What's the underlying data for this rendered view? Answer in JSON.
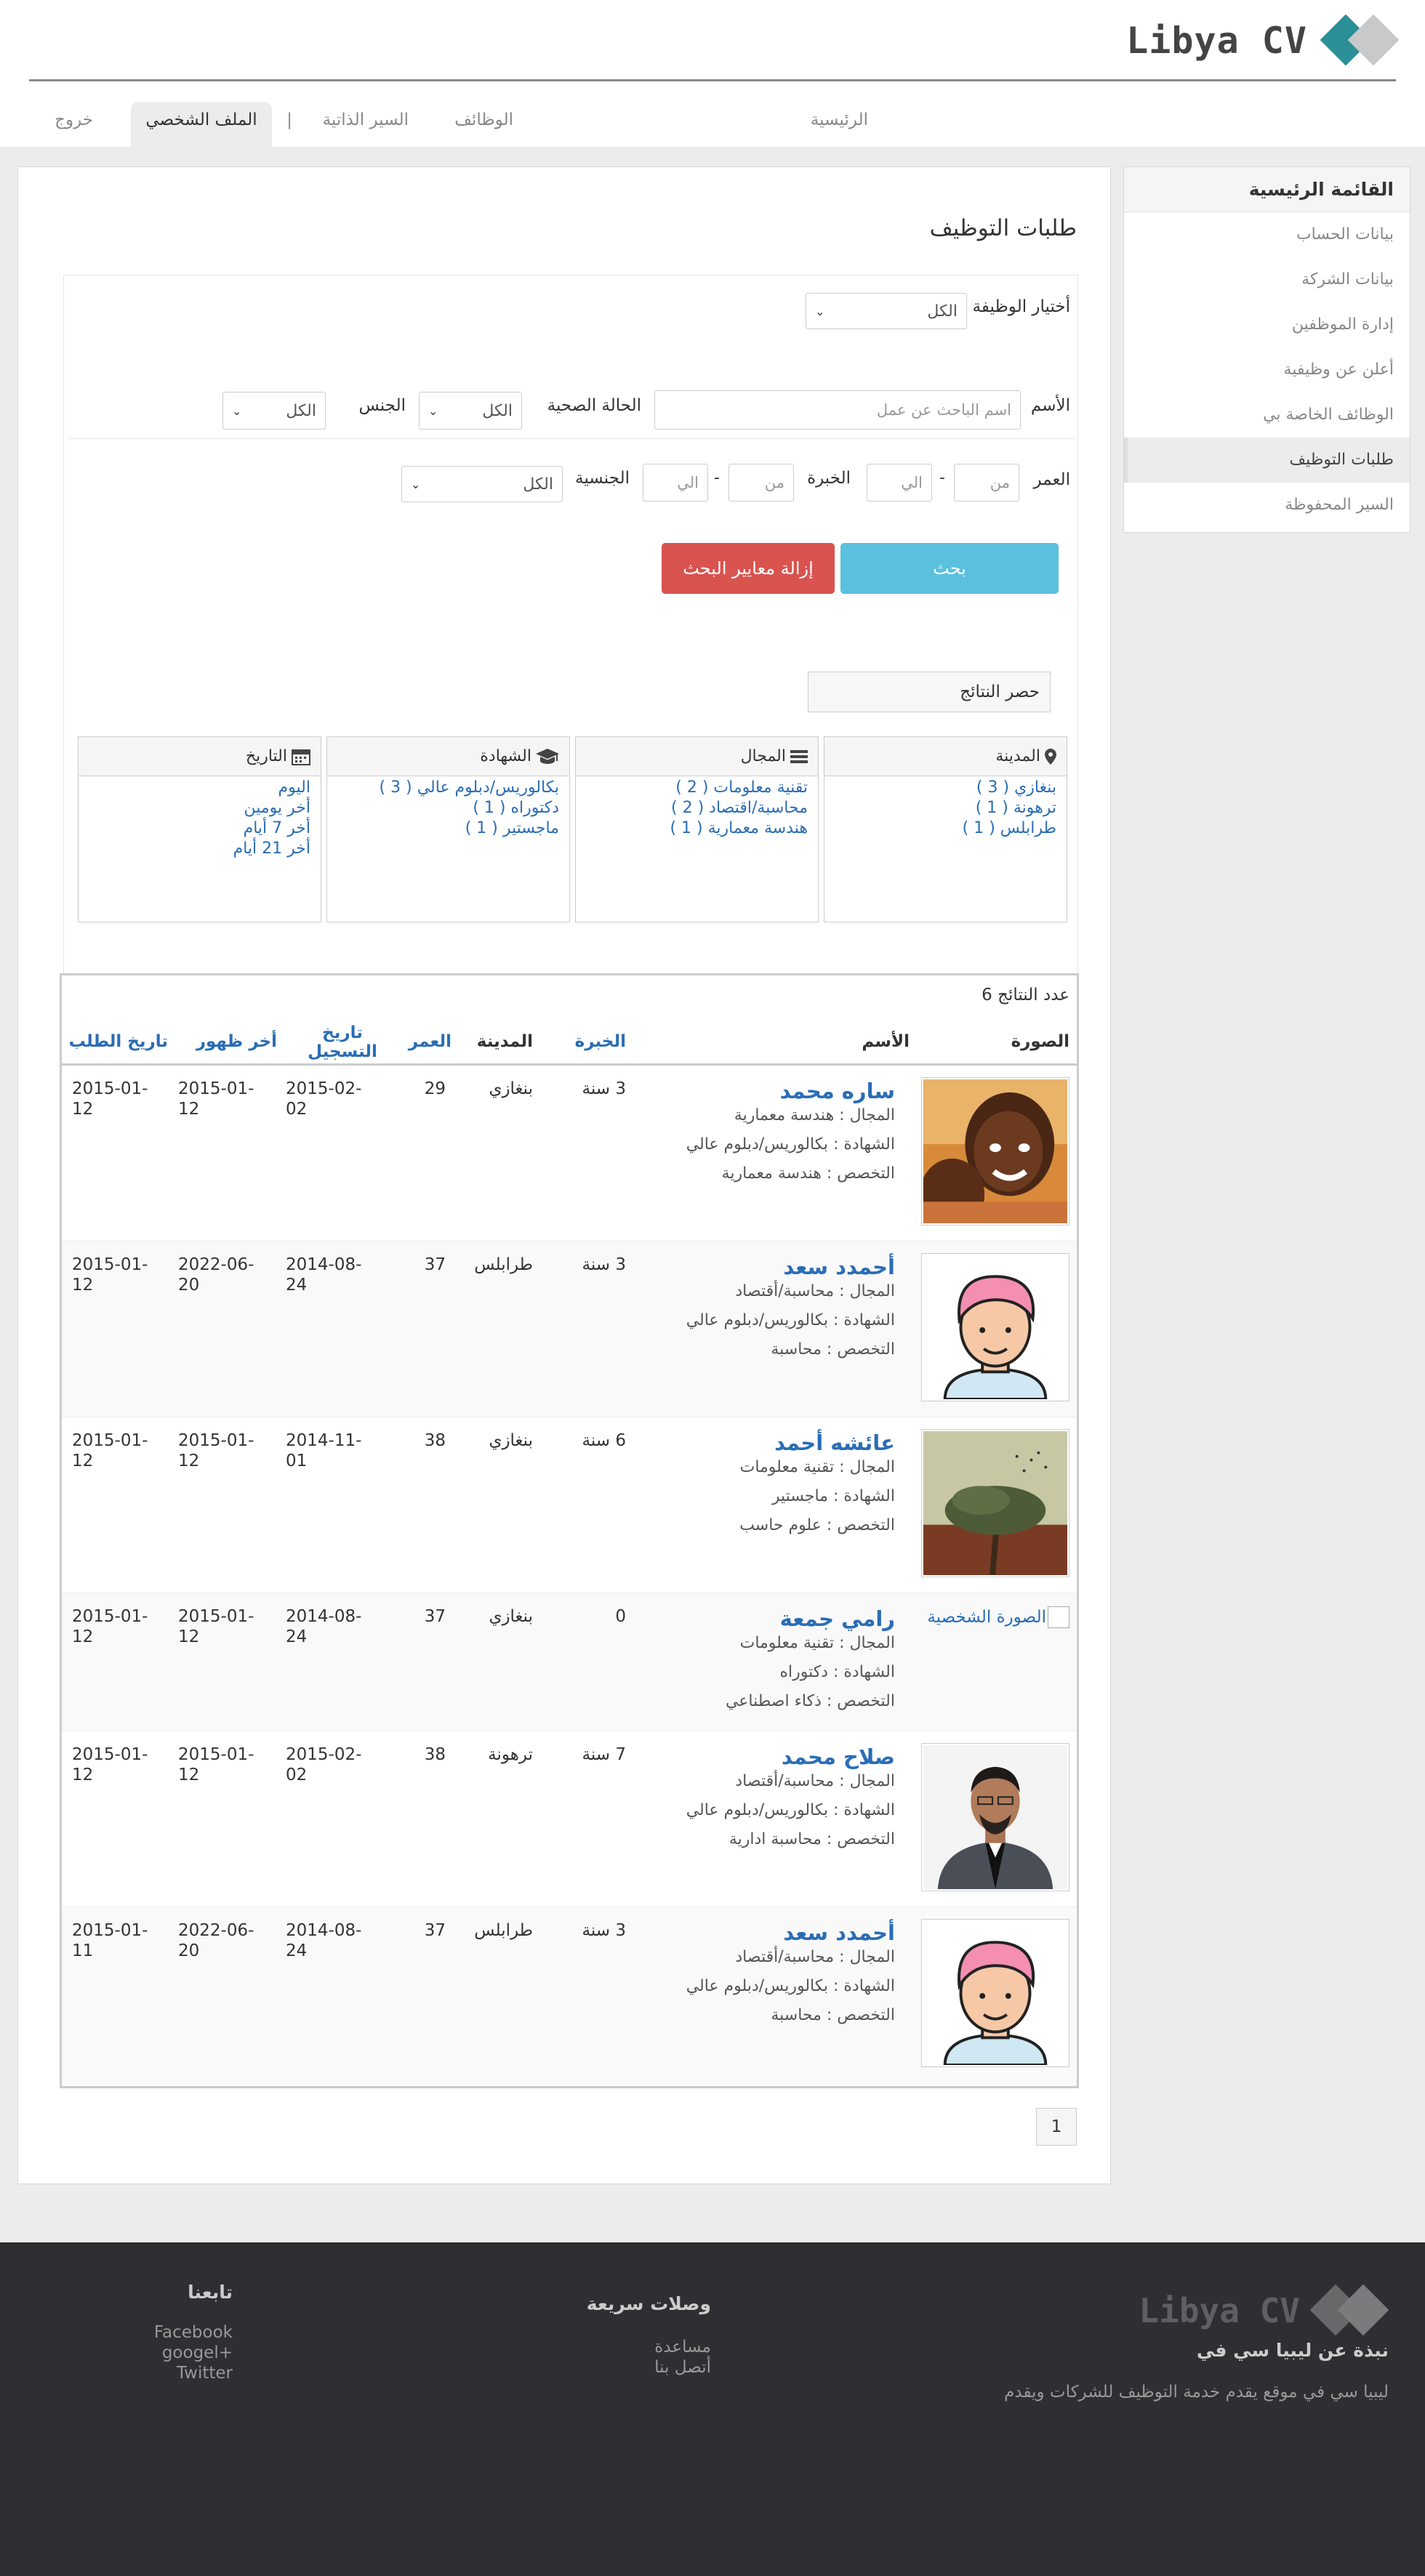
{
  "site": {
    "logo_text": "Libya CV"
  },
  "nav": {
    "home": "الرئيسية",
    "jobs": "الوظائف",
    "cvs": "السير الذاتية",
    "separator": "|",
    "profile": "الملف الشخصي",
    "logout": "خروج"
  },
  "sidebar": {
    "title": "القائمة الرئيسية",
    "items": [
      {
        "label": "بيانات الحساب"
      },
      {
        "label": "بيانات الشركة"
      },
      {
        "label": "إدارة الموظفين"
      },
      {
        "label": "أعلن عن وظيفية"
      },
      {
        "label": "الوظائف الخاصة بي"
      },
      {
        "label": "طلبات التوظيف"
      },
      {
        "label": "السير المحفوظة"
      }
    ]
  },
  "page": {
    "title": "طلبات التوظيف"
  },
  "search": {
    "job_label": "أختيار الوظيفة",
    "job_value": "الكل",
    "name_label": "الأسم",
    "name_placeholder": "اسم الباحث عن عمل",
    "health_label": "الحالة الصحية",
    "health_value": "الكل",
    "gender_label": "الجنس",
    "gender_value": "الكل",
    "age_label": "العمر",
    "age_from": "من",
    "age_to": "الي",
    "exp_label": "الخبرة",
    "exp_from": "من",
    "exp_to": "الي",
    "nationality_label": "الجنسية",
    "nationality_value": "الكل",
    "dash": "-",
    "search_button": "بحث",
    "clear_button": "إزالة معايير البحث",
    "narrow_label": "حصر النتائج"
  },
  "facets": {
    "city": {
      "title": "المدينة",
      "items": [
        "بنغازي ( 3 )",
        "ترهونة ( 1 )",
        "طرابلس ( 1 )"
      ]
    },
    "field": {
      "title": "المجال",
      "items": [
        "تقنية معلومات ( 2 )",
        "محاسبة/اقتصاد ( 2 )",
        "هندسة معمارية ( 1 )"
      ]
    },
    "degree": {
      "title": "الشهادة",
      "items": [
        "بكالوريس/دبلوم عالي ( 3 )",
        "دكتوراه ( 1 )",
        "ماجستير ( 1 )"
      ]
    },
    "date": {
      "title": "التاريخ",
      "items": [
        "اليوم",
        "أخر يومين",
        "أخر 7 أيام",
        "أخر 21 أيام"
      ]
    }
  },
  "results": {
    "count_text": "عدد النتائج 6",
    "headers": {
      "photo": "الصورة",
      "name": "الأسم",
      "experience": "الخبرة",
      "city": "المدينة",
      "age": "العمر",
      "registered": "تاريخ التسجيل",
      "last_seen": "أخر ظهور",
      "applied": "تاريخ الطلب"
    },
    "rows": [
      {
        "name": "ساره محمد",
        "field": "المجال : هندسة معمارية",
        "degree": "الشهادة : بكالوريس/دبلوم عالي",
        "major": "التخصص : هندسة معمارية",
        "experience": "3 سنة",
        "city": "بنغازي",
        "age": "29",
        "registered": "2015-02-02",
        "last_seen": "2015-01-12",
        "applied": "2015-01-12",
        "photo": "child"
      },
      {
        "name": "أحمدد سعد",
        "field": "المجال : محاسبة/أقتصاد",
        "degree": "الشهادة : بكالوريس/دبلوم عالي",
        "major": "التخصص : محاسبة",
        "experience": "3 سنة",
        "city": "طرابلس",
        "age": "37",
        "registered": "2014-08-24",
        "last_seen": "2022-06-20",
        "applied": "2015-01-12",
        "photo": "cartoon"
      },
      {
        "name": "عائشه أحمد",
        "field": "المجال : تقنية معلومات",
        "degree": "الشهادة : ماجستير",
        "major": "التخصص : علوم حاسب",
        "experience": "6 سنة",
        "city": "بنغازي",
        "age": "38",
        "registered": "2014-11-01",
        "last_seen": "2015-01-12",
        "applied": "2015-01-12",
        "photo": "tree"
      },
      {
        "name": "رامي جمعة",
        "field": "المجال : تقنية معلومات",
        "degree": "الشهادة : دكتوراه",
        "major": "التخصص : ذكاء اصطناعي",
        "experience": "0",
        "city": "بنغازي",
        "age": "37",
        "registered": "2014-08-24",
        "last_seen": "2015-01-12",
        "applied": "2015-01-12",
        "photo": "broken",
        "photo_alt": "الصورة الشخصية"
      },
      {
        "name": "صلاح محمد",
        "field": "المجال : محاسبة/أقتصاد",
        "degree": "الشهادة : بكالوريس/دبلوم عالي",
        "major": "التخصص : محاسبة ادارية",
        "experience": "7 سنة",
        "city": "ترهونة",
        "age": "38",
        "registered": "2015-02-02",
        "last_seen": "2015-01-12",
        "applied": "2015-01-12",
        "photo": "man"
      },
      {
        "name": "أحمدد سعد",
        "field": "المجال : محاسبة/أقتصاد",
        "degree": "الشهادة : بكالوريس/دبلوم عالي",
        "major": "التخصص : محاسبة",
        "experience": "3 سنة",
        "city": "طرابلس",
        "age": "37",
        "registered": "2014-08-24",
        "last_seen": "2022-06-20",
        "applied": "2015-01-11",
        "photo": "cartoon"
      }
    ]
  },
  "pagination": {
    "current": "1"
  },
  "footer": {
    "logo_text": "Libya CV",
    "about_title": "نبذة عن ليبيا سي في",
    "about_text": "ليبيا سي في موقع يقدم خدمة التوظيف للشركات ويقدم",
    "links_title": "وصلات سريعة",
    "links": [
      "مساعدة",
      "أتصل بنا"
    ],
    "follow_title": "تابعنا",
    "social": [
      "Facebook",
      "+googel",
      "Twitter"
    ]
  },
  "icons": {
    "city": "map-marker-icon",
    "field": "list-icon",
    "degree": "graduation-cap-icon",
    "date": "calendar-icon",
    "select": "chevron-down-icon"
  },
  "colors": {
    "link": "#2a6db5",
    "search_button": "#5bc0de",
    "clear_button": "#d9534f",
    "logo_teal": "#2b8f98",
    "footer_bg": "#2e2e33"
  }
}
